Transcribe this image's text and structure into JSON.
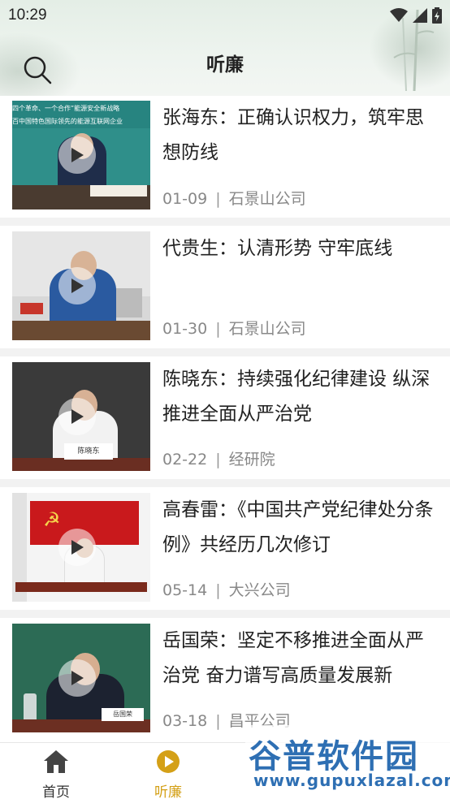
{
  "status_bar": {
    "time": "10:29"
  },
  "header": {
    "title": "听廉"
  },
  "items": [
    {
      "title": "张海东：正确认识权力，筑牢思想防线",
      "date": "01-09",
      "source": "石景山公司",
      "thumb_caption_1": "四个革命、一个合作”能源安全新战略",
      "thumb_caption_2": "百中国特色国际领先的能源互联网企业"
    },
    {
      "title": "代贵生：认清形势 守牢底线",
      "date": "01-30",
      "source": "石景山公司"
    },
    {
      "title": "陈晓东：持续强化纪律建设 纵深推进全面从严治党",
      "date": "02-22",
      "source": "经研院",
      "nameplate": "陈晓东"
    },
    {
      "title": "高春雷：《中国共产党纪律处分条例》共经历几次修订",
      "date": "05-14",
      "source": "大兴公司"
    },
    {
      "title": "岳国荣：坚定不移推进全面从严治党 奋力谱写高质量发展新",
      "date": "03-18",
      "source": "昌平公司",
      "nameplate": "岳国荣"
    }
  ],
  "tabbar": {
    "tabs": [
      {
        "label": "首页",
        "icon": "home-icon",
        "active": false
      },
      {
        "label": "听廉",
        "icon": "play-circle-icon",
        "active": true
      }
    ],
    "active_color": "#d4a017",
    "inactive_color": "#444444"
  },
  "watermark": {
    "text": "谷普软件园",
    "url": "www.gupuxlazal.com"
  }
}
